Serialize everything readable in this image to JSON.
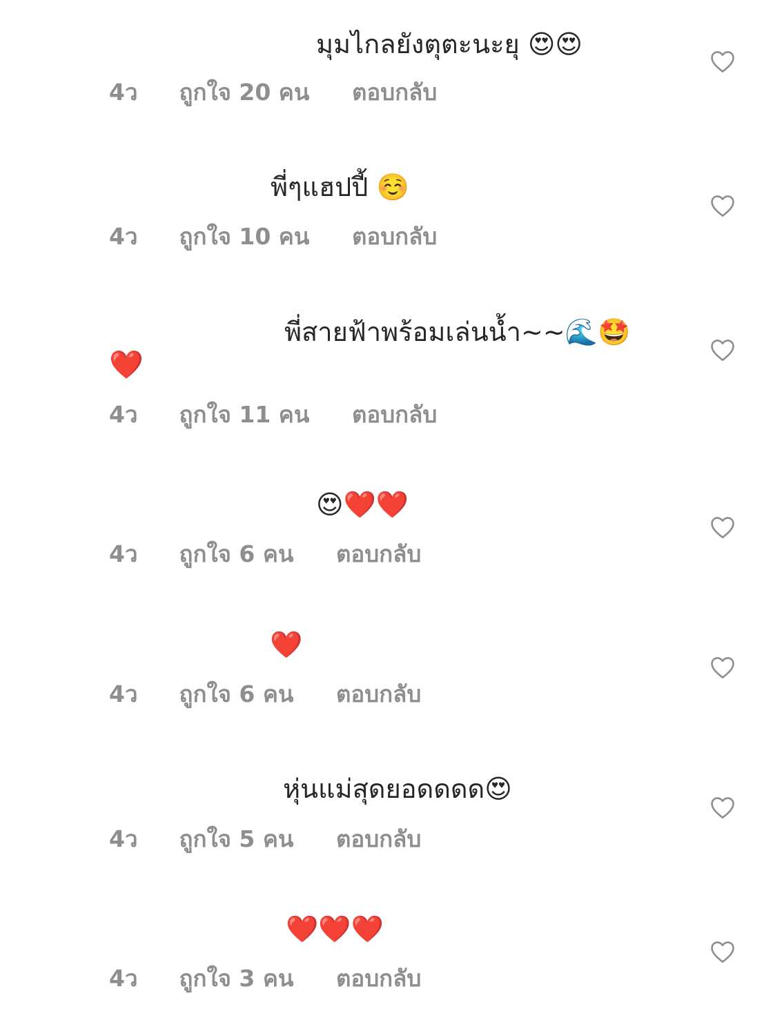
{
  "like_icon": "heart-outline-icon",
  "colors": {
    "text": "#262626",
    "meta": "#8e8e8e",
    "icon_stroke": "#8e8e8e"
  },
  "comments": [
    {
      "text": "มุมไกลยังตุตะนะยุ 😍😍",
      "text2": "",
      "time": "4ว",
      "likes": "ถูกใจ 20 คน",
      "reply": "ตอบกลับ"
    },
    {
      "text": "พี่ๆแฮปปี้ ☺️",
      "text2": "",
      "time": "4ว",
      "likes": "ถูกใจ 10 คน",
      "reply": "ตอบกลับ"
    },
    {
      "text": "พี่สายฟ้าพร้อมเล่นน้ำ~~🌊🤩",
      "text2": "❤️",
      "time": "4ว",
      "likes": "ถูกใจ 11 คน",
      "reply": "ตอบกลับ"
    },
    {
      "text": "😍❤️❤️",
      "text2": "",
      "time": "4ว",
      "likes": "ถูกใจ 6 คน",
      "reply": "ตอบกลับ"
    },
    {
      "text": "❤️",
      "text2": "",
      "time": "4ว",
      "likes": "ถูกใจ 6 คน",
      "reply": "ตอบกลับ"
    },
    {
      "text": "หุ่นแม่สุดยอดดดด😍",
      "text2": "",
      "time": "4ว",
      "likes": "ถูกใจ 5 คน",
      "reply": "ตอบกลับ"
    },
    {
      "text": "❤️❤️❤️",
      "text2": "",
      "time": "4ว",
      "likes": "ถูกใจ 3 คน",
      "reply": "ตอบกลับ"
    }
  ]
}
